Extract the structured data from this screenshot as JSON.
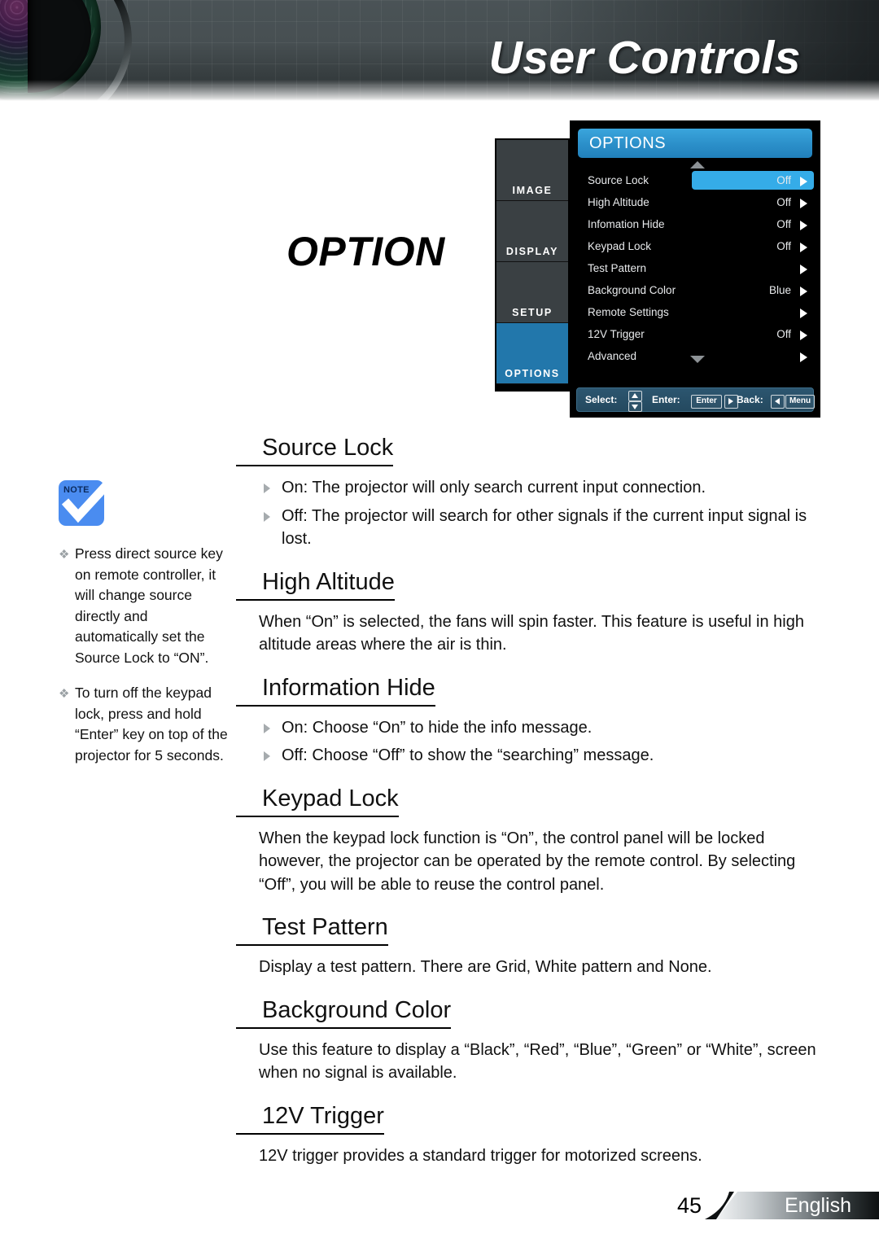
{
  "header": {
    "title": "User Controls",
    "lens_icon": "projector-lens-graphic"
  },
  "section_title": "OPTION",
  "osd": {
    "tabs": [
      {
        "label": "IMAGE",
        "active": false
      },
      {
        "label": "DISPLAY",
        "active": false
      },
      {
        "label": "SETUP",
        "active": false
      },
      {
        "label": "OPTIONS",
        "active": true
      }
    ],
    "panel_title": "OPTIONS",
    "scroll_up_icon": "scroll-up-arrow",
    "scroll_down_icon": "scroll-down-arrow",
    "rows": [
      {
        "label": "Source Lock",
        "value": "Off",
        "selected": true
      },
      {
        "label": "High Altitude",
        "value": "Off",
        "selected": false
      },
      {
        "label": "Infomation Hide",
        "value": "Off",
        "selected": false
      },
      {
        "label": "Keypad Lock",
        "value": "Off",
        "selected": false
      },
      {
        "label": "Test Pattern",
        "value": "",
        "selected": false
      },
      {
        "label": "Background Color",
        "value": "Blue",
        "selected": false
      },
      {
        "label": "Remote Settings",
        "value": "",
        "selected": false
      },
      {
        "label": "12V Trigger",
        "value": "Off",
        "selected": false
      },
      {
        "label": "Advanced",
        "value": "",
        "selected": false
      }
    ],
    "nav": {
      "select_label": "Select:",
      "enter_label": "Enter:",
      "back_label": "Back:",
      "enter_key": "Enter",
      "menu_key": "Menu"
    },
    "colors": {
      "highlight": "#35ace8",
      "tab_active": "#2277ab",
      "tab_inactive": "#3a4043",
      "panel_bg": "#000000",
      "nav_bg": "#2c5670"
    }
  },
  "note": {
    "icon_label": "NOTE",
    "items": [
      "Press direct source key on remote controller, it will change source directly and automatically set the Source Lock to “ON”.",
      "To turn off the keypad lock, press and hold “Enter” key on top of the projector for 5 seconds."
    ]
  },
  "sections": [
    {
      "heading": "Source Lock",
      "bullets": [
        "On: The projector will only search current input connection.",
        "Off: The projector will search for other signals if the current input signal is lost."
      ],
      "paragraph": ""
    },
    {
      "heading": "High Altitude",
      "bullets": [],
      "paragraph": "When “On” is selected, the fans will spin faster. This feature is useful in high altitude areas where the air is thin."
    },
    {
      "heading": "Information Hide",
      "bullets": [
        "On: Choose “On” to hide the info message.",
        "Off: Choose “Off” to show the “searching” message."
      ],
      "paragraph": ""
    },
    {
      "heading": "Keypad Lock",
      "bullets": [],
      "paragraph": "When the keypad lock function is “On”, the control panel will be locked however, the projector can be operated by the remote control. By selecting “Off”, you will be able to reuse the control panel."
    },
    {
      "heading": "Test Pattern",
      "bullets": [],
      "paragraph": "Display a test pattern. There are Grid, White pattern and None."
    },
    {
      "heading": "Background Color",
      "bullets": [],
      "paragraph": "Use this feature to display a “Black”, “Red”, “Blue”, “Green” or “White”, screen when no signal is available."
    },
    {
      "heading": "12V Trigger",
      "bullets": [],
      "paragraph": "12V trigger provides a standard trigger for motorized screens."
    }
  ],
  "footer": {
    "page_number": "45",
    "language": "English"
  }
}
